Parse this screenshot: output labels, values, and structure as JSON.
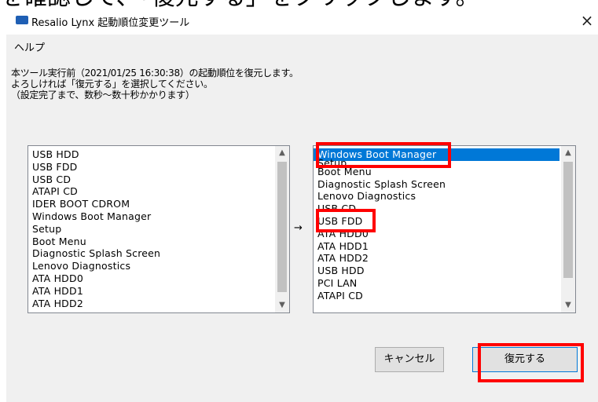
{
  "top_caption": "を確認して、「復元する」をクリックします。",
  "window": {
    "title": "Resalio Lynx 起動順位変更ツール",
    "close_symbol": "×"
  },
  "menu": {
    "help": "ヘルプ"
  },
  "description": {
    "line1": "本ツール実行前（2021/01/25 16:30:38）の起動順位を復元します。",
    "line2": "よろしければ「復元する」を選択してください。",
    "line3": "（設定完了まで、数秒～数十秒かかります）"
  },
  "left_list": {
    "items": [
      "USB HDD",
      "USB FDD",
      "USB CD",
      "ATAPI CD",
      "IDER BOOT CDROM",
      "Windows Boot Manager",
      "Setup",
      "Boot Menu",
      "Diagnostic Splash Screen",
      "Lenovo Diagnostics",
      "ATA HDD0",
      "ATA HDD1",
      "ATA HDD2"
    ]
  },
  "arrow": "→",
  "right_list": {
    "items": [
      "Windows Boot Manager",
      "Setup",
      "Boot Menu",
      "Diagnostic Splash Screen",
      "Lenovo Diagnostics",
      "USB CD",
      "USB FDD",
      "ATA HDD0",
      "ATA HDD1",
      "ATA HDD2",
      "USB HDD",
      "PCI LAN",
      "ATAPI CD"
    ],
    "selected": "Windows Boot Manager"
  },
  "buttons": {
    "cancel": "キャンセル",
    "restore": "復元する"
  },
  "scroll_symbols": {
    "up": "▲",
    "down": "▼"
  },
  "colors": {
    "highlight": "#ff0000",
    "selection": "#0078d7"
  }
}
